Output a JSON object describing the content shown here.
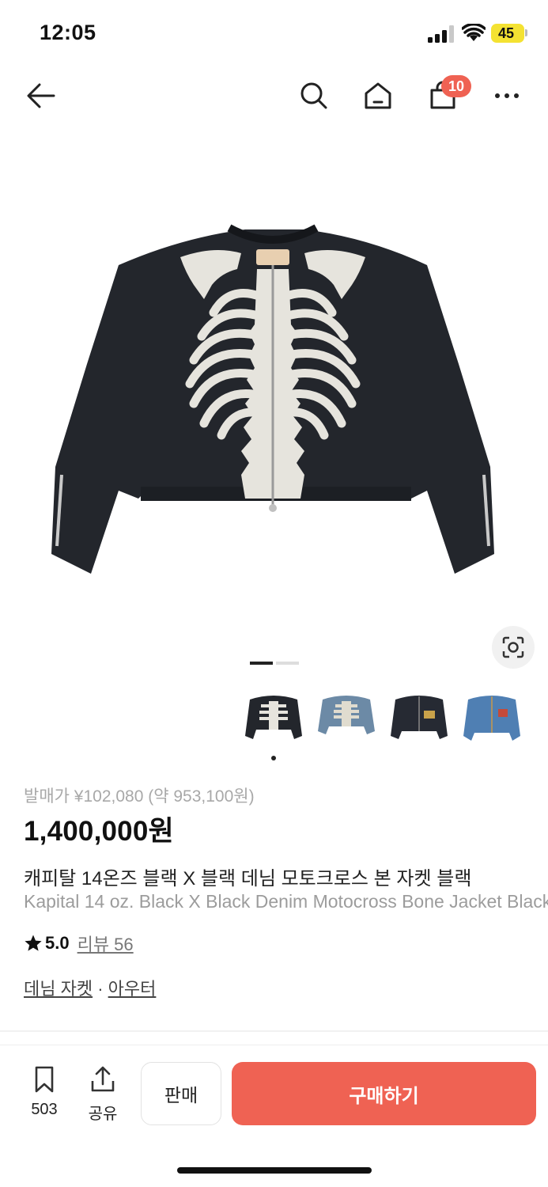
{
  "status": {
    "time": "12:05",
    "battery": "45"
  },
  "nav": {
    "cart_count": "10",
    "icons": [
      "back-arrow-icon",
      "search-icon",
      "home-icon",
      "cart-icon",
      "more-icon"
    ]
  },
  "product": {
    "release_price": "발매가 ¥102,080 (약 953,100원)",
    "price": "1,400,000원",
    "title_ko": "캐피탈 14온즈 블랙 X 블랙 데님 모토크로스 본 자켓 블랙",
    "title_en": "Kapital 14 oz. Black X Black Denim Motocross Bone Jacket Black",
    "rating": "5.0",
    "review_text": "리뷰 56",
    "category_1": "데님 자켓",
    "category_sep": " · ",
    "category_2": "아우터"
  },
  "bottom": {
    "bookmark_count": "503",
    "share_label": "공유",
    "sell_label": "판매",
    "buy_label": "구매하기"
  },
  "colors": {
    "accent": "#ef6253",
    "battery": "#f4e232"
  }
}
